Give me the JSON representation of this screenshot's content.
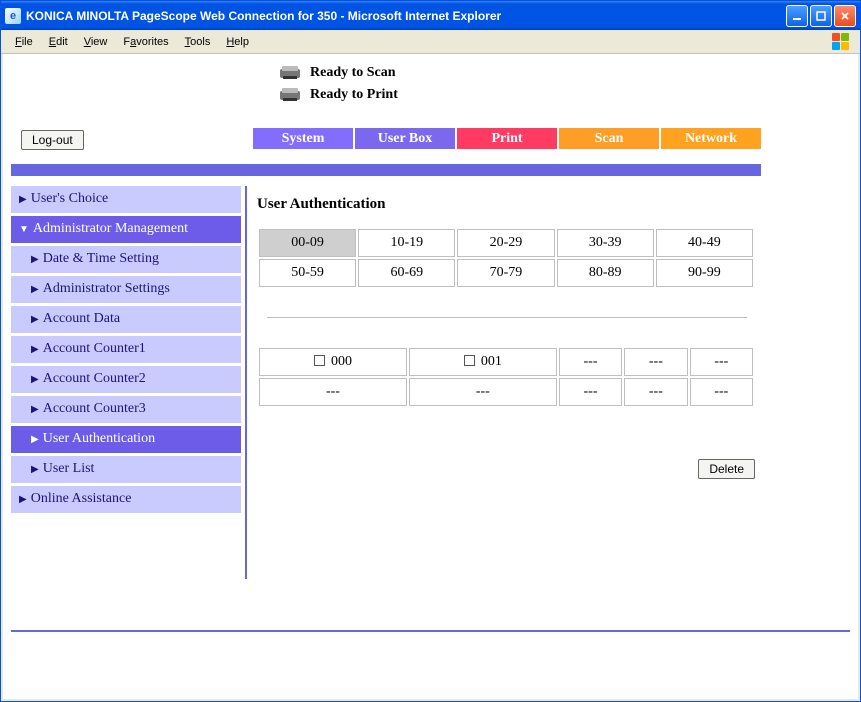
{
  "window": {
    "title": "KONICA MINOLTA PageScope Web Connection for 350 - Microsoft Internet Explorer"
  },
  "menubar": [
    {
      "pre": "",
      "u": "F",
      "post": "ile"
    },
    {
      "pre": "",
      "u": "E",
      "post": "dit"
    },
    {
      "pre": "",
      "u": "V",
      "post": "iew"
    },
    {
      "pre": "F",
      "u": "a",
      "post": "vorites"
    },
    {
      "pre": "",
      "u": "T",
      "post": "ools"
    },
    {
      "pre": "",
      "u": "H",
      "post": "elp"
    }
  ],
  "status": {
    "scan": "Ready to Scan",
    "print": "Ready to Print"
  },
  "logout_label": "Log-out",
  "tabs": {
    "system": "System",
    "userbox": "User Box",
    "print": "Print",
    "scan": "Scan",
    "network": "Network"
  },
  "sidebar": {
    "users_choice": "User's Choice",
    "admin_mgmt": "Administrator Management",
    "date_time": "Date & Time Setting",
    "admin_settings": "Administrator Settings",
    "account_data": "Account Data",
    "account_counter1": "Account Counter1",
    "account_counter2": "Account Counter2",
    "account_counter3": "Account Counter3",
    "user_auth": "User Authentication",
    "user_list": "User List",
    "online_assist": "Online Assistance"
  },
  "main": {
    "title": "User Authentication",
    "ranges": [
      [
        "00-09",
        "10-19",
        "20-29",
        "30-39",
        "40-49"
      ],
      [
        "50-59",
        "60-69",
        "70-79",
        "80-89",
        "90-99"
      ]
    ],
    "selected_range": "00-09",
    "users": [
      [
        {
          "label": "000",
          "checkbox": true
        },
        {
          "label": "001",
          "checkbox": true
        },
        {
          "label": "---",
          "checkbox": false
        },
        {
          "label": "---",
          "checkbox": false
        },
        {
          "label": "---",
          "checkbox": false
        }
      ],
      [
        {
          "label": "---",
          "checkbox": false
        },
        {
          "label": "---",
          "checkbox": false
        },
        {
          "label": "---",
          "checkbox": false
        },
        {
          "label": "---",
          "checkbox": false
        },
        {
          "label": "---",
          "checkbox": false
        }
      ]
    ],
    "delete_label": "Delete"
  }
}
